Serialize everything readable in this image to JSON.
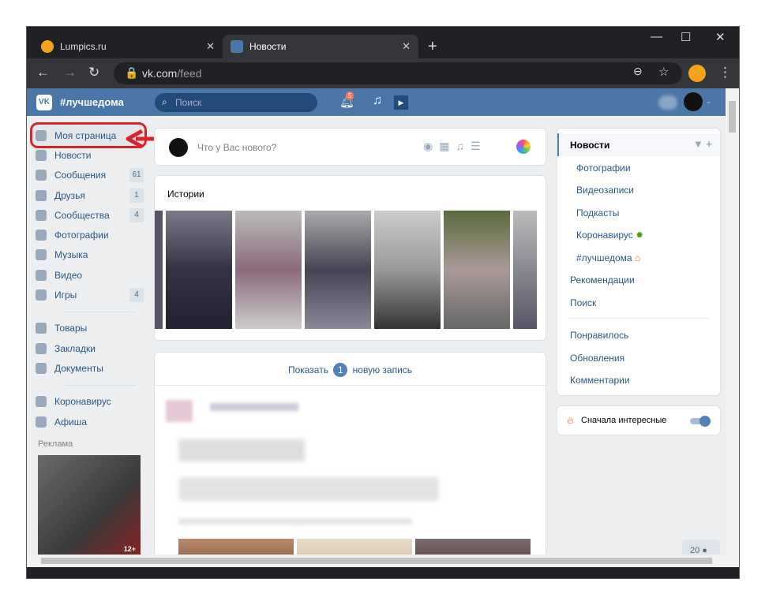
{
  "browser": {
    "tabs": [
      {
        "label": "Lumpics.ru",
        "favicon_color": "#f7a21c"
      },
      {
        "label": "Новости",
        "active": true
      }
    ],
    "url_host": "vk.com",
    "url_path": "/feed",
    "new_tab": "+"
  },
  "vk": {
    "brand_color": "#4a76a8",
    "title": "#лучшедома",
    "search_placeholder": "Поиск",
    "notifications": "5"
  },
  "left_nav": {
    "items": [
      {
        "label": "Моя страница",
        "icon": "home-icon"
      },
      {
        "label": "Новости",
        "icon": "news-icon"
      },
      {
        "label": "Сообщения",
        "icon": "messages-icon",
        "count": "61"
      },
      {
        "label": "Друзья",
        "icon": "friends-icon",
        "count": "1"
      },
      {
        "label": "Сообщества",
        "icon": "communities-icon",
        "count": "4"
      },
      {
        "label": "Фотографии",
        "icon": "camera-icon"
      },
      {
        "label": "Музыка",
        "icon": "music-icon"
      },
      {
        "label": "Видео",
        "icon": "video-icon"
      },
      {
        "label": "Игры",
        "icon": "gamepad-icon",
        "count": "4"
      }
    ],
    "items2": [
      {
        "label": "Товары",
        "icon": "bag-icon"
      },
      {
        "label": "Закладки",
        "icon": "star-icon"
      },
      {
        "label": "Документы",
        "icon": "document-icon"
      }
    ],
    "items3": [
      {
        "label": "Коронавирус",
        "icon": "virus-icon"
      },
      {
        "label": "Афиша",
        "icon": "play-icon"
      }
    ],
    "ads_label": "Реклама",
    "ad_badge": "12+"
  },
  "composer": {
    "placeholder": "Что у Вас нового?"
  },
  "stories": {
    "title": "Истории"
  },
  "feed": {
    "show_prefix": "Показать",
    "show_count": "1",
    "show_suffix": "новую запись"
  },
  "right_nav": {
    "items": [
      {
        "label": "Новости",
        "active": true
      },
      {
        "label": "Фотографии",
        "sub": true
      },
      {
        "label": "Видеозаписи",
        "sub": true
      },
      {
        "label": "Подкасты",
        "sub": true
      },
      {
        "label": "Коронавирус",
        "sub": true
      },
      {
        "label": "#лучшедома",
        "sub": true
      },
      {
        "label": "Рекомендации"
      },
      {
        "label": "Поиск"
      }
    ],
    "items2": [
      {
        "label": "Понравилось"
      },
      {
        "label": "Обновления"
      },
      {
        "label": "Комментарии"
      }
    ],
    "interesting_first": "Сначала интересные",
    "toggle_on": true
  },
  "online_count": "20"
}
